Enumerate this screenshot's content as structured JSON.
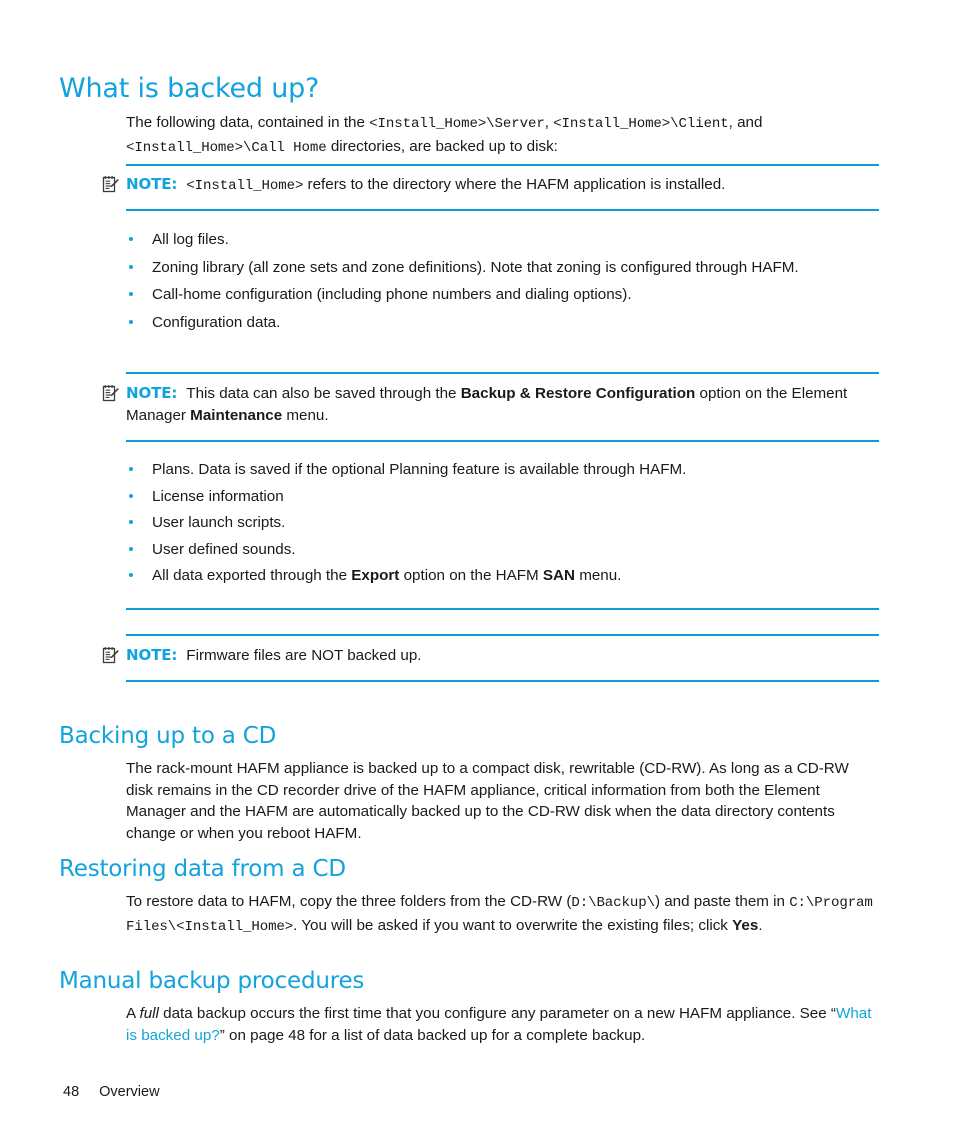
{
  "page": {
    "number": "48",
    "footer_section": "Overview"
  },
  "sections": {
    "what_is_backed_up": {
      "heading": "What is backed up?",
      "intro": {
        "t1": "The following data, contained in the ",
        "c1": "<Install_Home>\\Server",
        "t2": ", ",
        "c2": "<Install_Home>\\Client",
        "t3": ", and ",
        "c3": "<Install_Home>\\Call Home",
        "t4": " directories, are backed up to disk:"
      },
      "note1": {
        "label": "NOTE:",
        "code": "<Install_Home>",
        "text": " refers to the directory where the HAFM application is installed.",
        "icon": "note-pencil-icon"
      },
      "bullets1": [
        "All log files.",
        "Zoning library (all zone sets and zone definitions). Note that zoning is configured through HAFM.",
        "Call-home configuration (including phone numbers and dialing options).",
        "Configuration data."
      ],
      "note2": {
        "label": "NOTE:",
        "t1": "This data can also be saved through the ",
        "b1": "Backup & Restore Configuration",
        "t2": " option on the Element Manager ",
        "b2": "Maintenance",
        "t3": " menu.",
        "icon": "note-pencil-icon"
      },
      "bullets2": [
        "Plans. Data is saved if the optional Planning feature is available through HAFM.",
        "License information",
        "User launch scripts.",
        "User defined sounds."
      ],
      "bullet2_last": {
        "t1": "All data exported through the ",
        "b1": "Export",
        "t2": " option on the HAFM ",
        "b2": "SAN",
        "t3": " menu."
      },
      "note3": {
        "label": "NOTE:",
        "text": "Firmware files are NOT backed up.",
        "icon": "note-pencil-icon"
      }
    },
    "backing_up_to_cd": {
      "heading": "Backing up to a CD",
      "body": "The rack-mount HAFM appliance is backed up to a compact disk, rewritable (CD-RW). As long as a CD-RW disk remains in the CD recorder drive of the HAFM appliance, critical information from both the Element Manager and the HAFM are automatically backed up to the CD-RW disk when the data directory contents change or when you reboot HAFM."
    },
    "restoring_data_from_cd": {
      "heading": "Restoring data from a CD",
      "body": {
        "t1": "To restore data to HAFM, copy the three folders from the CD-RW (",
        "c1": "D:\\Backup\\",
        "t2": ") and paste them in ",
        "c2": "C:\\Program Files\\<Install_Home>",
        "t3": ". You will be asked if you want to overwrite the existing files; click ",
        "b1": "Yes",
        "t4": "."
      }
    },
    "manual_backup_procedures": {
      "heading": "Manual backup procedures",
      "body": {
        "t1": "A ",
        "i1": "full",
        "t2": " data backup occurs the first time that you configure any parameter on a new HAFM appliance. See “",
        "link1": "What is backed up?",
        "t3": "” on page 48 for a list of data backed up for a complete backup."
      }
    }
  },
  "colors": {
    "accent_cyan": "#13a3dc",
    "rule_cyan": "#0d9dd6",
    "body_text": "#1a1a1a"
  }
}
